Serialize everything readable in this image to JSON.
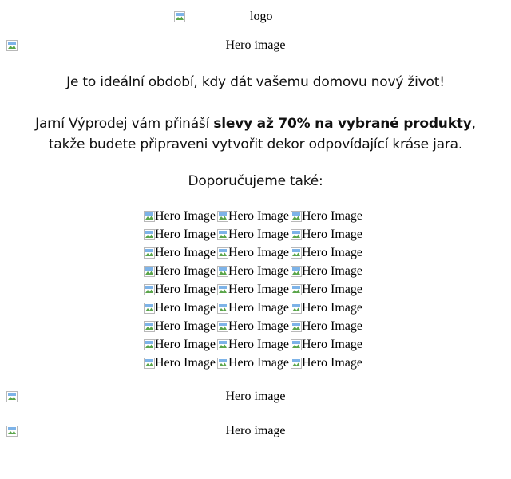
{
  "logo": {
    "alt": "logo"
  },
  "hero_top": {
    "alt": "Hero image"
  },
  "intro": {
    "line1": "Je to ideální období, kdy dát vašemu domovu nový život!",
    "line2_pre": "Jarní Výprodej vám přináší ",
    "line2_bold": "slevy až 70% na vybrané produkty",
    "line2_post": ",",
    "line3": "takže budete připraveni vytvořit dekor odpovídající kráse jara."
  },
  "recommend": {
    "heading": "Doporučujeme také:"
  },
  "product_grid": {
    "rows": [
      [
        "Hero Image",
        "Hero Image",
        "Hero Image"
      ],
      [
        "Hero Image",
        "Hero Image",
        "Hero Image"
      ],
      [
        "Hero Image",
        "Hero Image",
        "Hero Image"
      ],
      [
        "Hero Image",
        "Hero Image",
        "Hero Image"
      ],
      [
        "Hero Image",
        "Hero Image",
        "Hero Image"
      ],
      [
        "Hero Image",
        "Hero Image",
        "Hero Image"
      ],
      [
        "Hero Image",
        "Hero Image",
        "Hero Image"
      ],
      [
        "Hero Image",
        "Hero Image",
        "Hero Image"
      ],
      [
        "Hero Image",
        "Hero Image",
        "Hero Image"
      ]
    ]
  },
  "hero_bottom_1": {
    "alt": "Hero image"
  },
  "hero_bottom_2": {
    "alt": "Hero image"
  },
  "icons": {
    "broken_image": "broken-image-icon"
  }
}
